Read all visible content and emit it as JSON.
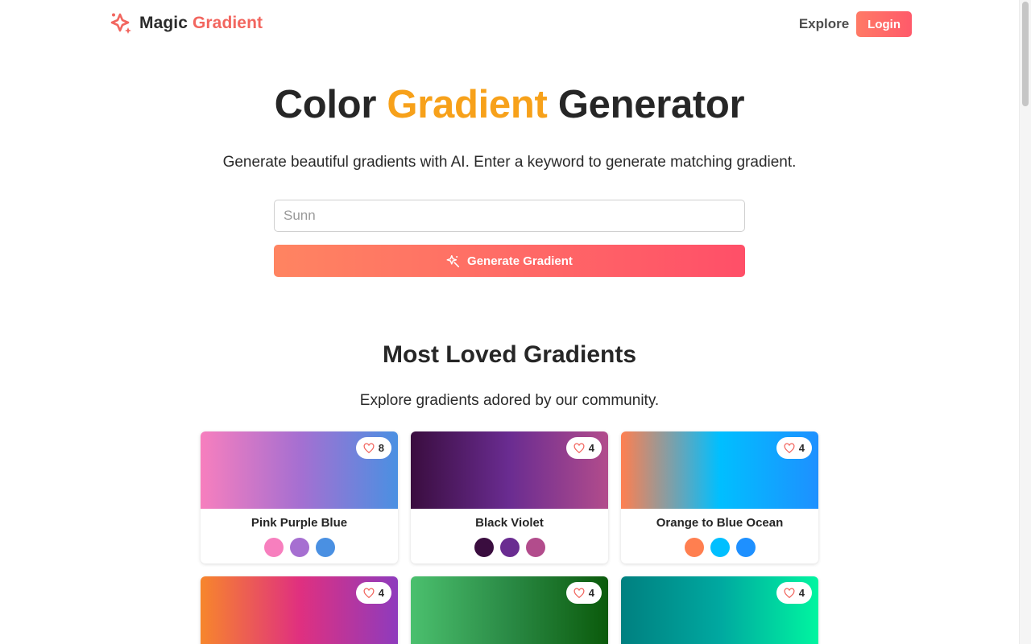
{
  "brand": {
    "name_part1": "Magic",
    "name_part2": "Gradient",
    "accent_color": "#f2665f"
  },
  "nav": {
    "explore_label": "Explore",
    "login_label": "Login"
  },
  "hero": {
    "title_part1": "Color",
    "title_highlight": "Gradient",
    "title_part2": "Generator",
    "subtitle": "Generate beautiful gradients with AI. Enter a keyword to generate matching gradient.",
    "highlight_color": "#f7a11a"
  },
  "search": {
    "value": "Sunn",
    "placeholder": "Sunn"
  },
  "generate_button": {
    "label": "Generate Gradient",
    "icon": "magic-wand-icon"
  },
  "loved": {
    "title": "Most Loved Gradients",
    "subtitle": "Explore gradients adored by our community.",
    "cards": [
      {
        "name": "Pink Purple Blue",
        "likes": "8",
        "colors": [
          "#f77fbe",
          "#a66fd1",
          "#4a90e2"
        ]
      },
      {
        "name": "Black Violet",
        "likes": "4",
        "colors": [
          "#3a0d3f",
          "#6a2c91",
          "#b24c8c"
        ]
      },
      {
        "name": "Orange to Blue Ocean",
        "likes": "4",
        "colors": [
          "#ff7f50",
          "#00bfff",
          "#1e90ff"
        ]
      },
      {
        "name": "",
        "likes": "4",
        "colors": [
          "#f7862c",
          "#e0307f",
          "#8e3bbd"
        ]
      },
      {
        "name": "",
        "likes": "4",
        "colors": [
          "#4bc06e",
          "#2a8a45",
          "#0b5a0b"
        ]
      },
      {
        "name": "",
        "likes": "4",
        "colors": [
          "#008080",
          "#00a8a0",
          "#00f5a0"
        ]
      }
    ]
  }
}
